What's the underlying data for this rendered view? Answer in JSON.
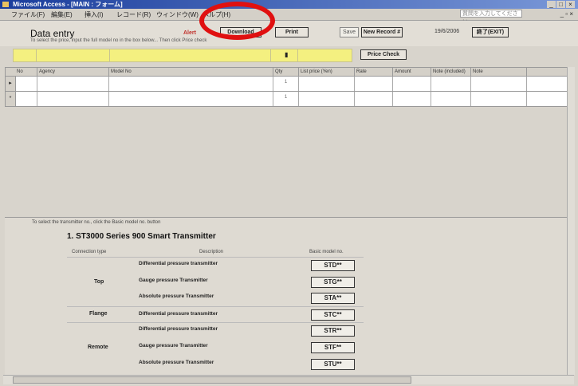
{
  "window": {
    "title": "Microsoft Access - [MAIN : フォーム]",
    "controls": [
      "_",
      "□",
      "×"
    ]
  },
  "menu": {
    "items": [
      "ファイル(F)",
      "編集(E)",
      "挿入(I)",
      "レコード(R)",
      "ウィンドウ(W)",
      "ヘルプ(H)"
    ],
    "help_placeholder": "質問を入力してください",
    "mdi_controls": "_ ▫ ×"
  },
  "header": {
    "title": "Data entry",
    "subtitle": "To select the price, input the full model no in the box below... Then click Price check",
    "error_label": "Alert",
    "buttons": {
      "download": "Download",
      "print": "Print",
      "save": "Save",
      "new_record": "New Record #",
      "exit": "終了(EXIT)"
    },
    "date": "19/6/2006",
    "price_check": "Price Check"
  },
  "grid": {
    "columns": [
      "No",
      "Agency",
      "Model No",
      "Qty",
      "List price (Yen)",
      "Rate",
      "Amount",
      "Note (included)",
      "Note"
    ],
    "rows": [
      {
        "marker": "▸",
        "qty": "1"
      },
      {
        "marker": "*",
        "qty": "1"
      }
    ]
  },
  "lower": {
    "note": "To select the transmitter no., click the Basic model no. button",
    "section_title": "1. ST3000 Series 900 Smart Transmitter",
    "table_headers": [
      "Connection type",
      "Description",
      "Basic model no."
    ],
    "groups": [
      {
        "type": "Top",
        "rows": [
          {
            "desc": "Differential pressure transmitter",
            "code": "STD**"
          },
          {
            "desc": "Gauge pressure Transmitter",
            "code": "STG**"
          },
          {
            "desc": "Absolute pressure Transmitter",
            "code": "STA**"
          }
        ]
      },
      {
        "type": "Flange",
        "rows": [
          {
            "desc": "Differential pressure transmitter",
            "code": "STC**"
          }
        ]
      },
      {
        "type": "Remote",
        "rows": [
          {
            "desc": "Differential pressure transmitter",
            "code": "STR**"
          },
          {
            "desc": "Gauge pressure Transmitter",
            "code": "STF**"
          },
          {
            "desc": "Absolute pressure Transmitter",
            "code": "STU**"
          }
        ]
      }
    ]
  },
  "annotation": {
    "color": "#e01010"
  }
}
